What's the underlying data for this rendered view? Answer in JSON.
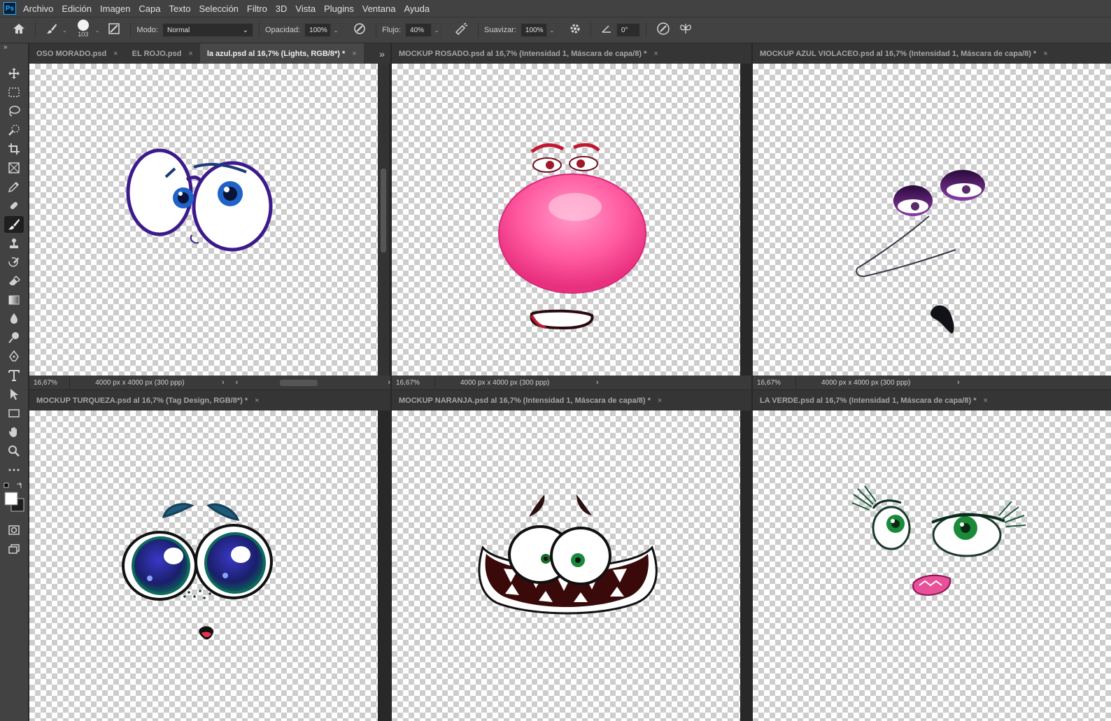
{
  "app": {
    "logo": "Ps"
  },
  "menu": [
    "Archivo",
    "Edición",
    "Imagen",
    "Capa",
    "Texto",
    "Selección",
    "Filtro",
    "3D",
    "Vista",
    "Plugins",
    "Ventana",
    "Ayuda"
  ],
  "options": {
    "brush_size": "103",
    "mode_label": "Modo:",
    "mode_value": "Normal",
    "opacity_label": "Opacidad:",
    "opacity_value": "100%",
    "flow_label": "Flujo:",
    "flow_value": "40%",
    "smoothing_label": "Suavizar:",
    "smoothing_value": "100%",
    "angle_value": "0°"
  },
  "docs": {
    "d1": {
      "tabs": [
        "OSO MORADO.psd",
        "EL ROJO.psd",
        "la azul.psd al 16,7% (Lights, RGB/8*) *"
      ],
      "zoom": "16,67%",
      "dims": "4000 px x 4000 px (300 ppp)"
    },
    "d2": {
      "title": "MOCKUP ROSADO.psd al 16,7% (Intensidad 1, Máscara de capa/8) *",
      "zoom": "16,67%",
      "dims": "4000 px x 4000 px (300 ppp)"
    },
    "d3": {
      "title": "MOCKUP AZUL VIOLACEO.psd al 16,7% (Intensidad 1, Máscara de capa/8) *",
      "zoom": "16,67%",
      "dims": "4000 px x 4000 px (300 ppp)"
    },
    "d4": {
      "title": "MOCKUP TURQUEZA.psd al 16,7% (Tag Design, RGB/8*) *"
    },
    "d5": {
      "title": "MOCKUP NARANJA.psd al 16,7% (Intensidad 1, Máscara de capa/8) *"
    },
    "d6": {
      "title": "LA VERDE.psd al 16,7% (Intensidad 1, Máscara de capa/8) *"
    }
  },
  "glyphs": {
    "close": "×",
    "more": "»",
    "chev_right": "›",
    "chev_left": "‹",
    "caret": "⌄",
    "collapse": "»"
  }
}
